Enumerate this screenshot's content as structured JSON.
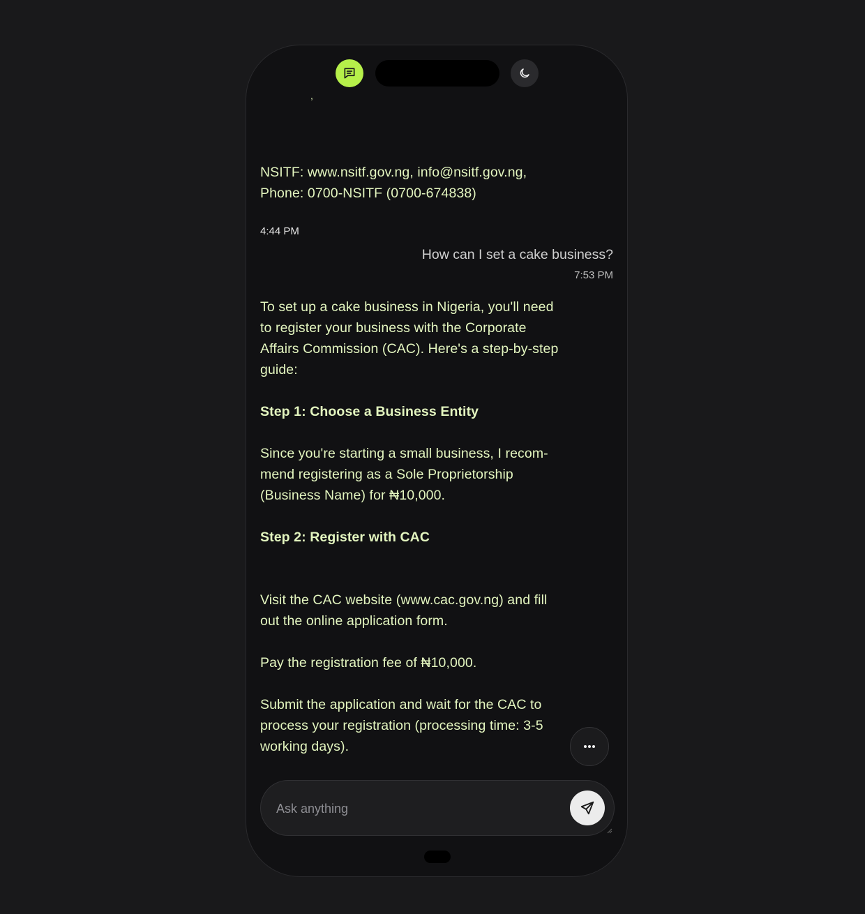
{
  "header": {
    "chat_icon": "chat-bubble-icon",
    "theme_icon": "moon-icon"
  },
  "messages": {
    "partial_top": ",",
    "ai_contact": "NSITF: www.nsitf.gov.ng, info@nsitf.gov.ng, Phone: 0700-NSITF (0700-674838)",
    "ai_contact_time": "4:44 PM",
    "user_question": "How can I set a cake business?",
    "user_question_time": "7:53 PM",
    "ai_intro": "To set up a cake business in Nigeria, you'll need to register your business with the Corporate Affairs Commission (CAC). Here's a step-by-step guide:",
    "step1_title": "Step 1: Choose a Business Entity",
    "step1_body": "Since you're starting a small business, I recom-mend registering as a Sole Proprietorship (Business Name) for ₦10,000.",
    "step2_title": "Step 2: Register with CAC",
    "step2_point1": "Visit the CAC website (www.cac.gov.ng) and fill out the online application form.",
    "step2_point2": "Pay the registration fee of ₦10,000.",
    "step2_point3": "Submit the application and wait for the CAC to process your registration (processing time: 3-5 working days)."
  },
  "composer": {
    "placeholder": "Ask anything",
    "more_icon": "ellipsis-icon",
    "send_icon": "send-icon"
  },
  "colors": {
    "accent": "#b6f04a",
    "ai_text": "#e3f5bf",
    "background": "#111113"
  }
}
